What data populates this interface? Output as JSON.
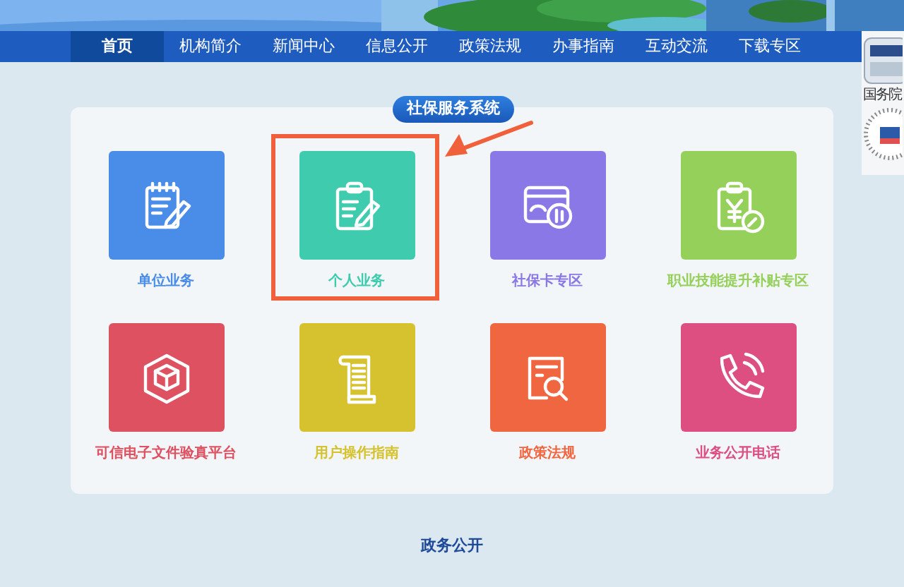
{
  "nav": [
    {
      "label": "首页",
      "selected": true
    },
    {
      "label": "机构简介",
      "selected": false
    },
    {
      "label": "新闻中心",
      "selected": false
    },
    {
      "label": "信息公开",
      "selected": false
    },
    {
      "label": "政策法规",
      "selected": false
    },
    {
      "label": "办事指南",
      "selected": false
    },
    {
      "label": "互动交流",
      "selected": false
    },
    {
      "label": "下载专区",
      "selected": false
    }
  ],
  "side_widget": {
    "caption": "国务院"
  },
  "panel": {
    "title": "社保服务系统",
    "tiles": [
      {
        "label": "单位业务",
        "kind": "notepad",
        "color": "#4a8de8",
        "highlighted": false
      },
      {
        "label": "个人业务",
        "kind": "clipboard",
        "color": "#3ecbae",
        "highlighted": true
      },
      {
        "label": "社保卡专区",
        "kind": "card",
        "color": "#8a78e6",
        "highlighted": false
      },
      {
        "label": "职业技能提升补贴专区",
        "kind": "subsidy",
        "color": "#95d05a",
        "highlighted": false
      },
      {
        "label": "可信电子文件验真平台",
        "kind": "cube",
        "color": "#de5160",
        "highlighted": false
      },
      {
        "label": "用户操作指南",
        "kind": "scroll",
        "color": "#d6c22e",
        "highlighted": false
      },
      {
        "label": "政策法规",
        "kind": "search-doc",
        "color": "#f06640",
        "highlighted": false
      },
      {
        "label": "业务公开电话",
        "kind": "phone",
        "color": "#dd4f80",
        "highlighted": false
      }
    ]
  },
  "section_title": "政务公开"
}
